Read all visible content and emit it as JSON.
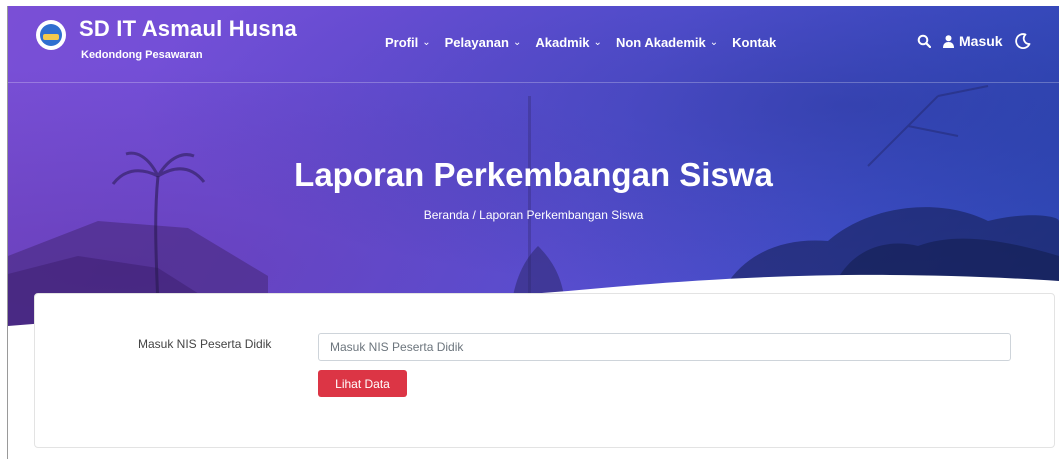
{
  "brand": {
    "title": "SD IT Asmaul Husna",
    "subtitle": "Kedondong Pesawaran",
    "logo_icon": "school-emblem-icon"
  },
  "nav": {
    "items": [
      {
        "label": "Profil",
        "has_dropdown": true
      },
      {
        "label": "Pelayanan",
        "has_dropdown": true
      },
      {
        "label": "Akadmik",
        "has_dropdown": true
      },
      {
        "label": "Non Akademik",
        "has_dropdown": true
      },
      {
        "label": "Kontak",
        "has_dropdown": false
      }
    ],
    "search_icon": "search-icon",
    "login_label": "Masuk",
    "login_icon": "user-icon",
    "theme_icon": "moon-icon"
  },
  "hero": {
    "title": "Laporan Perkembangan Siswa",
    "breadcrumb_home": "Beranda",
    "breadcrumb_separator": "/",
    "breadcrumb_current": "Laporan Perkembangan Siswa"
  },
  "form": {
    "label": "Masuk NIS Peserta Didik",
    "input_value": "",
    "input_placeholder": "Masuk NIS Peserta Didik",
    "submit_label": "Lihat Data"
  },
  "colors": {
    "hero_start": "#7a4fd6",
    "hero_end": "#2f4ab8",
    "button": "#dc3545"
  }
}
